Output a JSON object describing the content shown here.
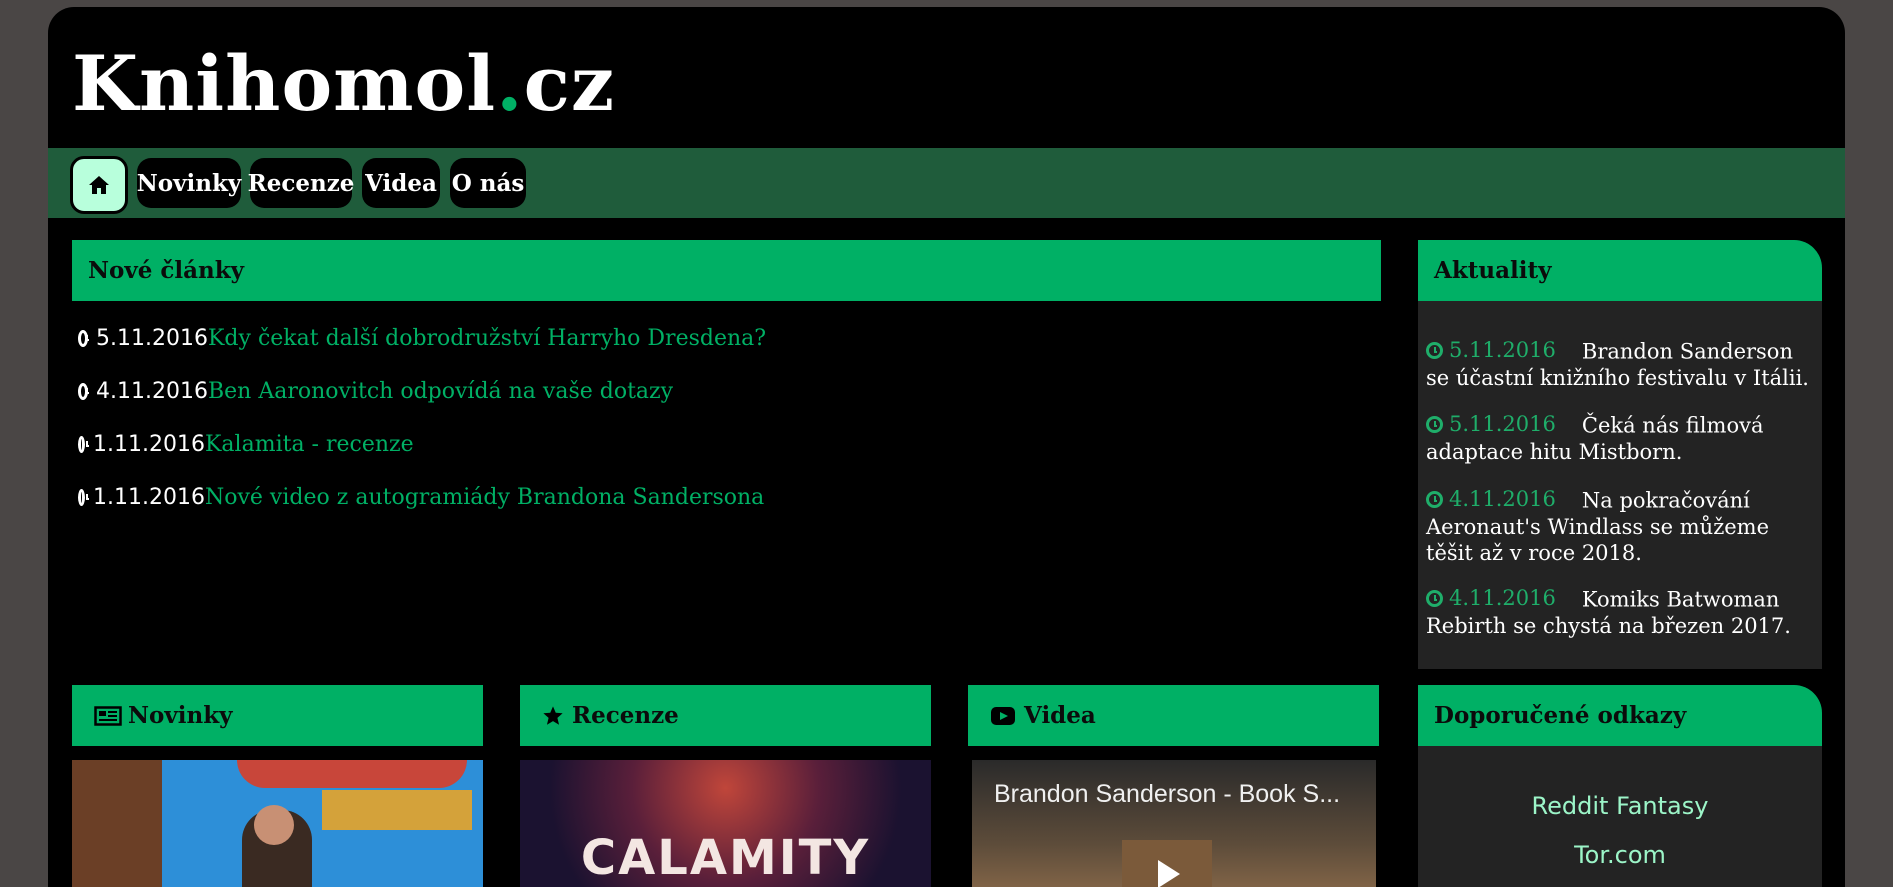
{
  "site": {
    "title_main": "Knihomol",
    "title_dot": ".",
    "title_tld": "cz"
  },
  "nav": {
    "home_icon": "home-icon",
    "items": [
      "Novinky",
      "Recenze",
      "Videa",
      "O nás"
    ]
  },
  "new_articles": {
    "heading": "Nové články",
    "items": [
      {
        "date": "5.11.2016",
        "title": "Kdy čekat další dobrodružství Harryho Dresdena?"
      },
      {
        "date": "4.11.2016",
        "title": "Ben Aaronovitch odpovídá na vaše dotazy"
      },
      {
        "date": "1.11.2016",
        "title": "Kalamita - recenze"
      },
      {
        "date": "1.11.2016",
        "title": "Nové video z autogramiády Brandona Sandersona"
      }
    ]
  },
  "news": {
    "heading": "Aktuality",
    "items": [
      {
        "date": "5.11.2016",
        "text": "Brandon Sanderson se účastní knižního festivalu v Itálii."
      },
      {
        "date": "5.11.2016",
        "text": "Čeká nás filmová adaptace hitu Mistborn."
      },
      {
        "date": "4.11.2016",
        "text": "Na pokračování Aeronaut's Windlass se můžeme těšit až v roce 2018."
      },
      {
        "date": "4.11.2016",
        "text": "Komiks Batwoman Rebirth se chystá na březen 2017."
      }
    ]
  },
  "cards": [
    {
      "heading": "Novinky",
      "icon": "newspaper-icon"
    },
    {
      "heading": "Recenze",
      "icon": "star-icon"
    },
    {
      "heading": "Videa",
      "icon": "youtube-icon",
      "video_title": "Brandon Sanderson - Book S..."
    }
  ],
  "cover_text": "CALAMITY",
  "links": {
    "heading": "Doporučené odkazy",
    "items": [
      "Reddit Fantasy",
      "Tor.com"
    ]
  },
  "colors": {
    "accent": "#00b065",
    "nav_bar": "#1f5c3b",
    "sidebar_bg": "#232323"
  }
}
